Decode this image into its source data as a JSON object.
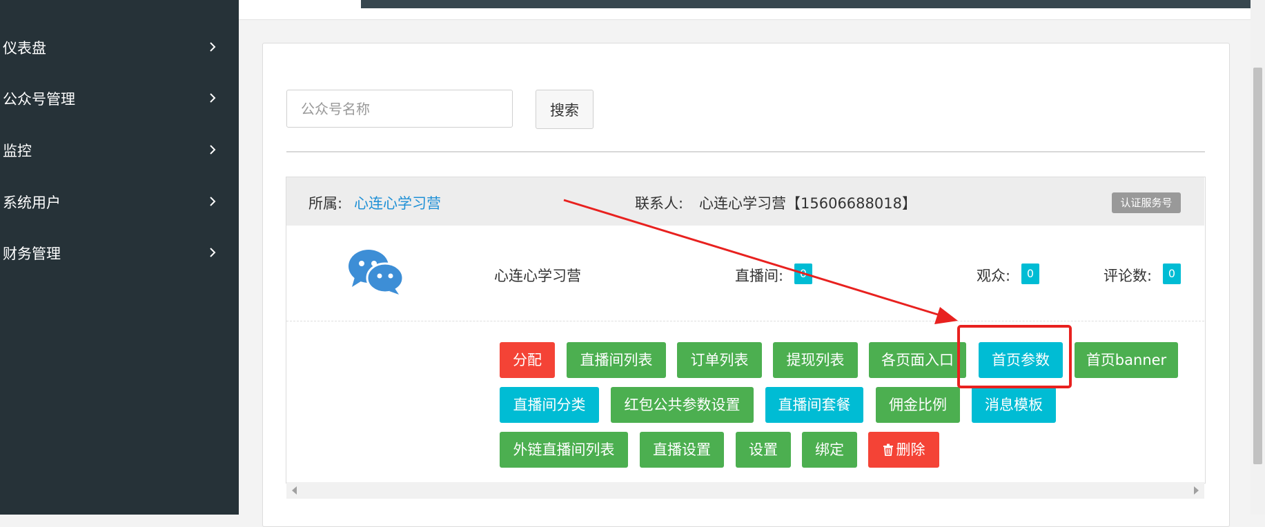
{
  "sidebar": {
    "items": [
      {
        "label": "仪表盘",
        "icon": "chevron-right-icon"
      },
      {
        "label": "公众号管理",
        "icon": "chevron-right-icon"
      },
      {
        "label": "监控",
        "icon": "chevron-right-icon"
      },
      {
        "label": "系统用户",
        "icon": "chevron-right-icon"
      },
      {
        "label": "财务管理",
        "icon": "chevron-right-icon"
      }
    ]
  },
  "search": {
    "placeholder": "公众号名称",
    "value": "",
    "button_label": "搜索"
  },
  "card": {
    "owner_label": "所属:",
    "owner_name": "心连心学习营",
    "contact_label": "联系人:",
    "contact_value": "心连心学习营【15606688018】",
    "account_type_badge": "认证服务号",
    "account_icon": "wechat-icon",
    "account_name": "心连心学习营",
    "stats": {
      "live_rooms_label": "直播间:",
      "live_rooms_value": "0",
      "audience_label": "观众:",
      "audience_value": "0",
      "comments_label": "评论数:",
      "comments_value": "0"
    },
    "actions": {
      "assign": "分配",
      "live_room_list": "直播间列表",
      "order_list": "订单列表",
      "withdraw_list": "提现列表",
      "page_entries": "各页面入口",
      "home_params": "首页参数",
      "home_banner": "首页banner",
      "live_room_category": "直播间分类",
      "red_packet_settings": "红包公共参数设置",
      "live_room_package": "直播间套餐",
      "commission_ratio": "佣金比例",
      "message_template": "消息模板",
      "external_live_list": "外链直播间列表",
      "live_settings": "直播设置",
      "settings": "设置",
      "bind": "绑定",
      "delete": "删除"
    }
  },
  "colors": {
    "sidebar_bg": "#263238",
    "green": "#4caf50",
    "cyan": "#00bcd4",
    "red": "#f44336",
    "link": "#1e90d6",
    "annotation": "#e8211f"
  }
}
